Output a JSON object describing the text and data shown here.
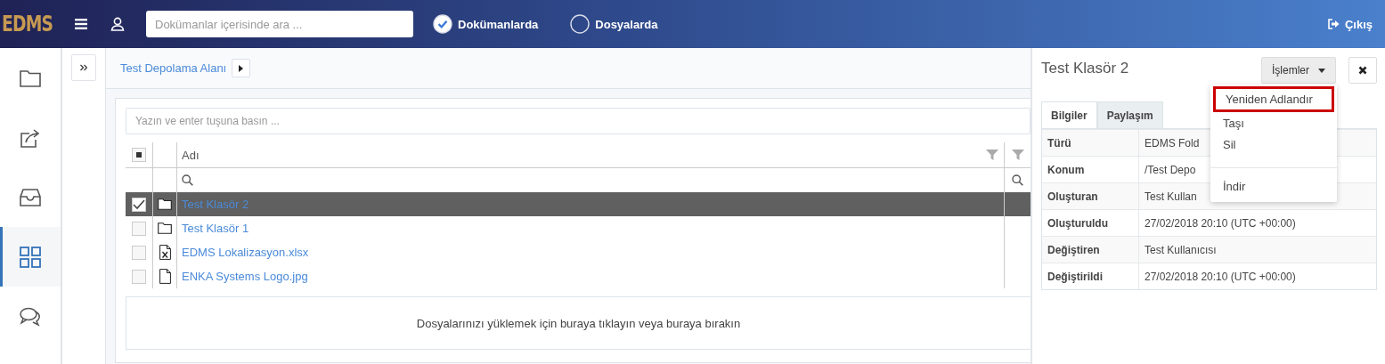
{
  "header": {
    "logo": "EDMS",
    "search": {
      "placeholder": "Dokümanlar içerisinde ara ..."
    },
    "scopes": [
      {
        "label": "Dokümanlarda",
        "selected": true
      },
      {
        "label": "Dosyalarda",
        "selected": false
      }
    ],
    "logout": "Çıkış"
  },
  "sidebar": {
    "items": [
      {
        "kind": "folder",
        "selected": false
      },
      {
        "kind": "share",
        "selected": false
      },
      {
        "kind": "inbox",
        "selected": false
      },
      {
        "kind": "grid",
        "selected": true
      },
      {
        "kind": "chat",
        "selected": false
      }
    ]
  },
  "breadcrumb": {
    "label": "Test Depolama Alanı"
  },
  "filter": {
    "placeholder": "Yazın ve enter tuşuna basın ..."
  },
  "table": {
    "header_checkbox": {
      "indeterminate": true
    },
    "columns": [
      {
        "label": "Adı"
      }
    ],
    "rows": [
      {
        "name": "Test Klasör 2",
        "kind": "folder",
        "checked": true,
        "selected": true
      },
      {
        "name": "Test Klasör 1",
        "kind": "folder",
        "checked": false,
        "selected": false
      },
      {
        "name": "EDMS Lokalizasyon.xlsx",
        "kind": "excel",
        "checked": false,
        "selected": false
      },
      {
        "name": "ENKA Systems Logo.jpg",
        "kind": "file",
        "checked": false,
        "selected": false
      }
    ]
  },
  "upload": {
    "text": "Dosyalarınızı yüklemek için buraya tıklayın veya buraya bırakın"
  },
  "detail": {
    "title": "Test Klasör 2",
    "actions": "İşlemler",
    "tabs": [
      {
        "label": "Bilgiler",
        "selected": true
      },
      {
        "label": "Paylaşım",
        "selected": false
      }
    ],
    "properties": [
      {
        "label": "Türü",
        "value": "EDMS Fold"
      },
      {
        "label": "Konum",
        "value": "/Test Depo"
      },
      {
        "label": "Oluşturan",
        "value": "Test Kullan"
      },
      {
        "label": "Oluşturuldu",
        "value": "27/02/2018 20:10 (UTC +00:00)"
      },
      {
        "label": "Değiştiren",
        "value": "Test Kullanıcısı"
      },
      {
        "label": "Değiştirildi",
        "value": "27/02/2018 20:10 (UTC +00:00)"
      }
    ]
  },
  "menu": {
    "items": [
      {
        "label": "Yeniden Adlandır",
        "highlighted": true,
        "separated": false
      },
      {
        "label": "Taşı",
        "highlighted": false,
        "separated": false
      },
      {
        "label": "Sil",
        "highlighted": false,
        "separated": false
      },
      {
        "label": "İndir",
        "highlighted": false,
        "separated": true
      }
    ]
  }
}
